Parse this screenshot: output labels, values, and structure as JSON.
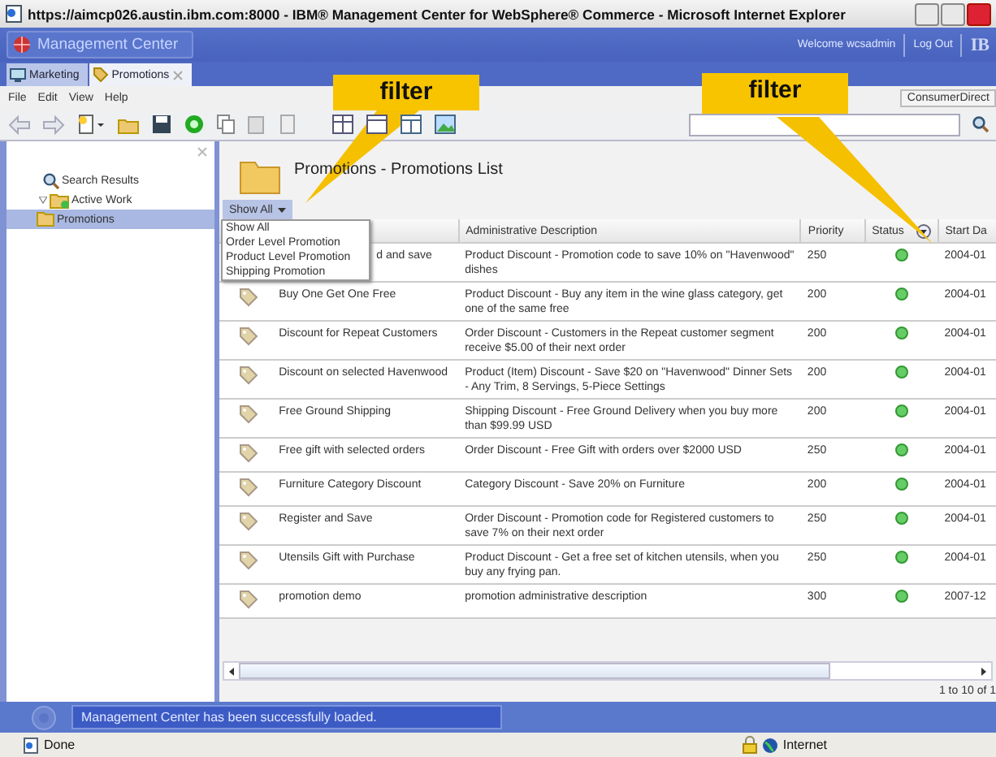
{
  "window": {
    "title": "https://aimcp026.austin.ibm.com:8000 - IBM® Management Center for WebSphere® Commerce - Microsoft Internet Explorer"
  },
  "app_header": {
    "title": "Management Center",
    "welcome": "Welcome wcsadmin",
    "logout": "Log Out",
    "logo": "IB"
  },
  "tabs": [
    {
      "label": "Marketing",
      "selected": false
    },
    {
      "label": "Promotions",
      "selected": true
    }
  ],
  "menu": [
    "File",
    "Edit",
    "View",
    "Help"
  ],
  "store_button": "ConsumerDirect",
  "sidebar": {
    "items": [
      {
        "label": "Search Results",
        "kind": "search",
        "selected": false
      },
      {
        "label": "Active Work",
        "kind": "work",
        "selected": false,
        "expanded": true,
        "children": [
          {
            "label": "Promotions",
            "kind": "folder",
            "selected": true
          }
        ]
      }
    ]
  },
  "page_title": "Promotions - Promotions List",
  "filter": {
    "value": "Show All",
    "options": [
      "Show All",
      "Order Level Promotion",
      "Product Level Promotion",
      "Shipping Promotion"
    ]
  },
  "table": {
    "columns": [
      "",
      "Administrative Description",
      "Priority",
      "Status",
      "Start Da"
    ],
    "rows": [
      {
        "name": "d and save",
        "description": "Product Discount - Promotion code to save 10% on \"Havenwood\" dishes",
        "priority": "250",
        "active": true,
        "start": "2004-01"
      },
      {
        "name": "Buy One Get One Free",
        "description": "Product Discount - Buy any item in the wine glass category, get one of the same free",
        "priority": "200",
        "active": true,
        "start": "2004-01"
      },
      {
        "name": "Discount for Repeat Customers",
        "description": "Order Discount - Customers in the Repeat customer segment receive $5.00 of their next order",
        "priority": "200",
        "active": true,
        "start": "2004-01"
      },
      {
        "name": "Discount on selected Havenwood",
        "description": "Product (Item) Discount - Save $20 on \"Havenwood\" Dinner Sets - Any Trim, 8 Servings, 5-Piece Settings",
        "priority": "200",
        "active": true,
        "start": "2004-01"
      },
      {
        "name": "Free Ground Shipping",
        "description": "Shipping Discount - Free Ground Delivery when you buy more than $99.99 USD",
        "priority": "200",
        "active": true,
        "start": "2004-01"
      },
      {
        "name": "Free gift with selected orders",
        "description": "Order Discount - Free Gift with orders over $2000 USD",
        "priority": "250",
        "active": true,
        "start": "2004-01"
      },
      {
        "name": "Furniture Category Discount",
        "description": "Category Discount - Save 20% on Furniture",
        "priority": "200",
        "active": true,
        "start": "2004-01"
      },
      {
        "name": "Register and Save",
        "description": "Order Discount - Promotion code for Registered customers to save 7% on their next order",
        "priority": "250",
        "active": true,
        "start": "2004-01"
      },
      {
        "name": "Utensils Gift with Purchase",
        "description": "Product Discount - Get a free set of kitchen utensils, when you buy any frying pan.",
        "priority": "250",
        "active": true,
        "start": "2004-01"
      },
      {
        "name": "promotion demo",
        "description": "promotion administrative description",
        "priority": "300",
        "active": true,
        "start": "2007-12"
      }
    ]
  },
  "paging": "1 to 10 of 1",
  "message": "Management Center has been successfully loaded.",
  "status_bar": {
    "text": "Done",
    "zone": "Internet"
  },
  "callouts": [
    "filter",
    "filter"
  ]
}
